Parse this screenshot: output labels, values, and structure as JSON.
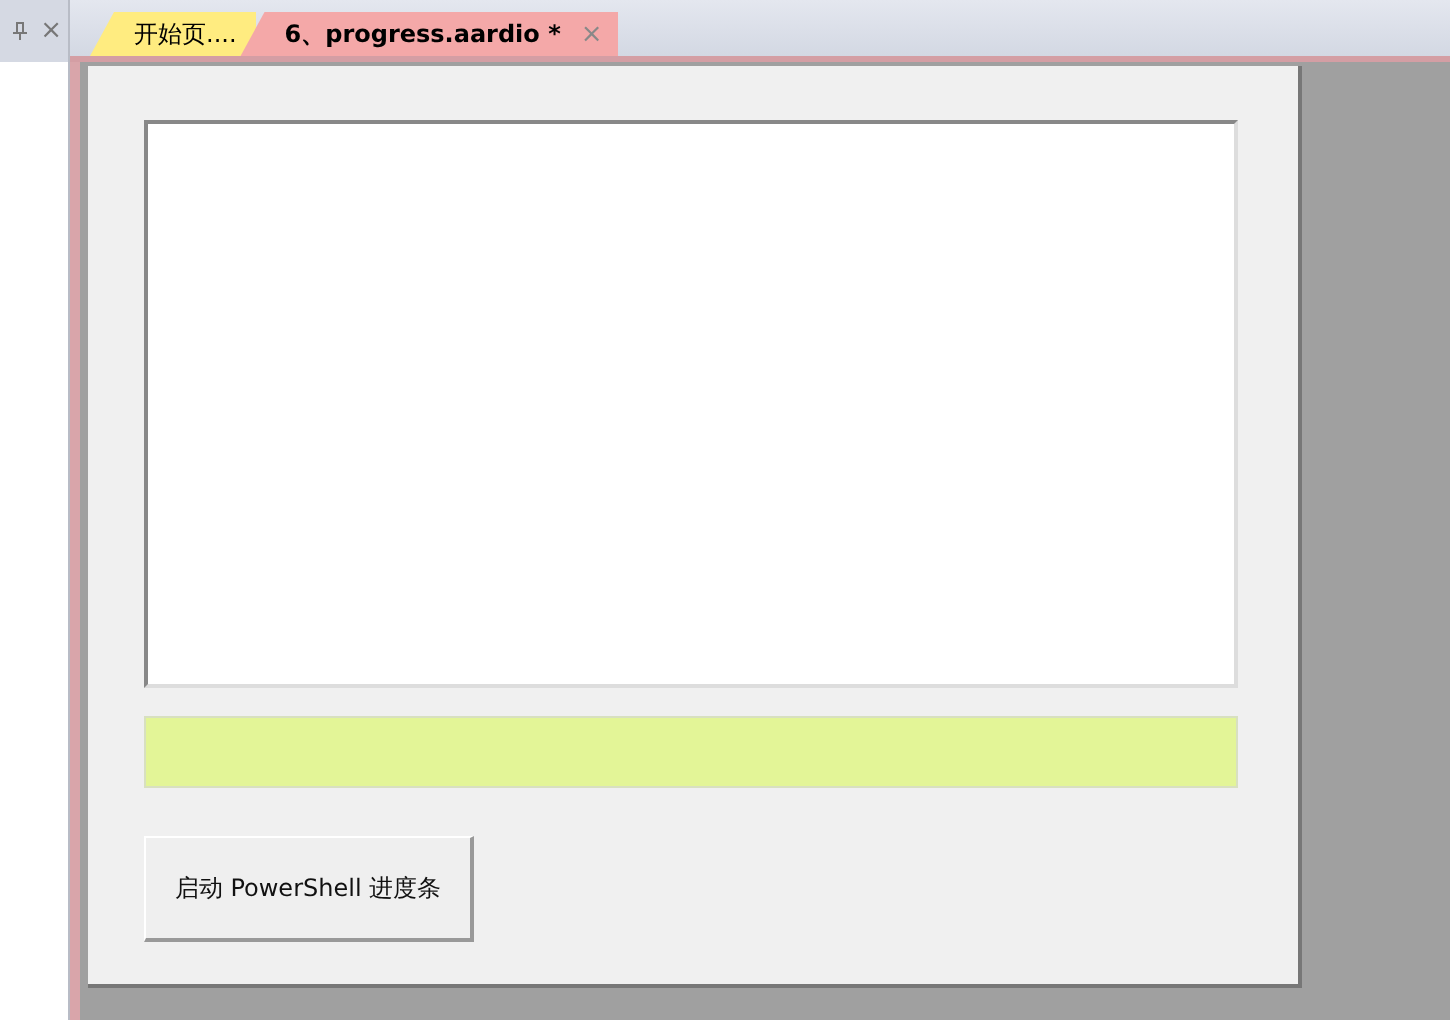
{
  "side_panel": {
    "close_glyph": "×"
  },
  "tabs": [
    {
      "label": "开始页....",
      "selected": false,
      "color": "#ffec80"
    },
    {
      "label": "6、progress.aardio *",
      "selected": true,
      "color": "#f4a8a8",
      "close": "×"
    }
  ],
  "form": {
    "progress": {
      "level": 1
    },
    "button": "启动 PowerShell 进度条"
  }
}
